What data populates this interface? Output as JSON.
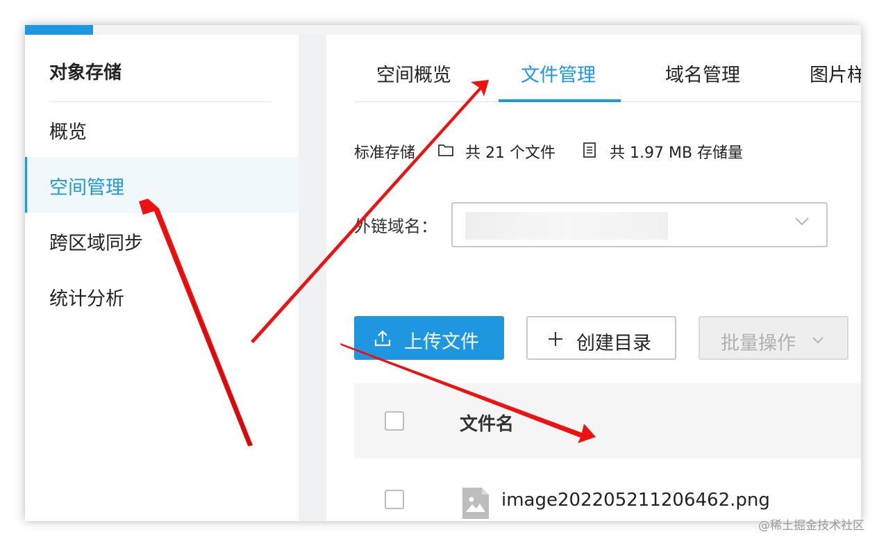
{
  "sidebar": {
    "title": "对象存储",
    "items": [
      {
        "label": "概览"
      },
      {
        "label": "空间管理"
      },
      {
        "label": "跨区域同步"
      },
      {
        "label": "统计分析"
      }
    ]
  },
  "tabs": [
    {
      "label": "空间概览"
    },
    {
      "label": "文件管理"
    },
    {
      "label": "域名管理"
    },
    {
      "label": "图片样"
    }
  ],
  "stats": {
    "storage_type": "标准存储",
    "file_count": "共 21 个文件",
    "storage_used": "共 1.97 MB 存储量"
  },
  "domain": {
    "label": "外链域名："
  },
  "toolbar": {
    "upload_label": "上传文件",
    "mkdir_label": "创建目录",
    "batch_label": "批量操作"
  },
  "table": {
    "header_name": "文件名",
    "rows": [
      {
        "name": "image202205211206462.png"
      }
    ]
  },
  "watermark": "@稀土掘金技术社区",
  "colors": {
    "accent": "#1e97e0",
    "annotation_arrow": "#ee1111"
  },
  "icons": [
    "folder-icon",
    "storage-icon",
    "chevron-down-icon",
    "upload-icon",
    "plus-icon",
    "image-file-icon",
    "arrow-annotation"
  ]
}
